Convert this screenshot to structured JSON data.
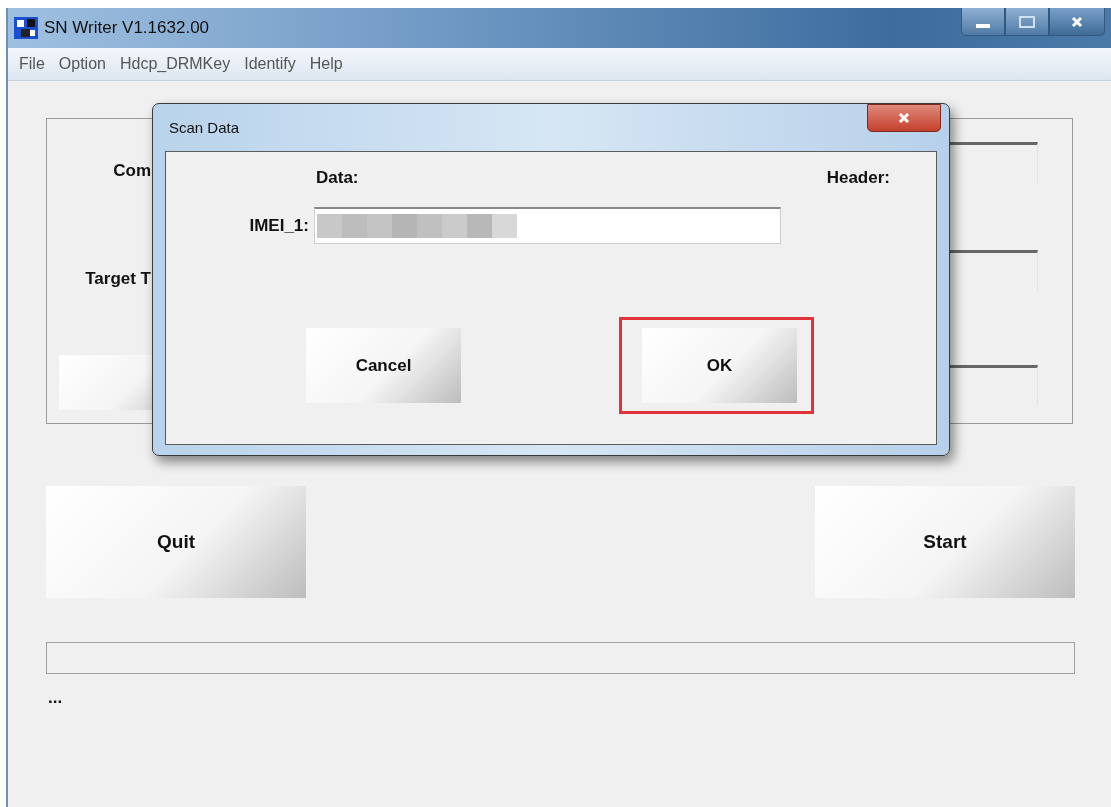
{
  "window": {
    "title": "SN Writer V1.1632.00"
  },
  "menu": [
    {
      "label": "File"
    },
    {
      "label": "Option"
    },
    {
      "label": "Hdcp_DRMKey"
    },
    {
      "label": "Identify"
    },
    {
      "label": "Help"
    }
  ],
  "settings": [
    {
      "label": "Com"
    },
    {
      "label": "Target T"
    }
  ],
  "buttons": [
    {
      "label": "Quit"
    },
    {
      "label": "Start"
    }
  ],
  "status_text": "...",
  "dialog": {
    "title": "Scan Data",
    "data_heading": "Data:",
    "header_heading": "Header:",
    "fields": [
      {
        "label": "IMEI_1:",
        "redacted": true
      }
    ],
    "buttons": [
      {
        "label": "Cancel",
        "highlighted": false
      },
      {
        "label": "OK",
        "highlighted": true
      }
    ]
  }
}
